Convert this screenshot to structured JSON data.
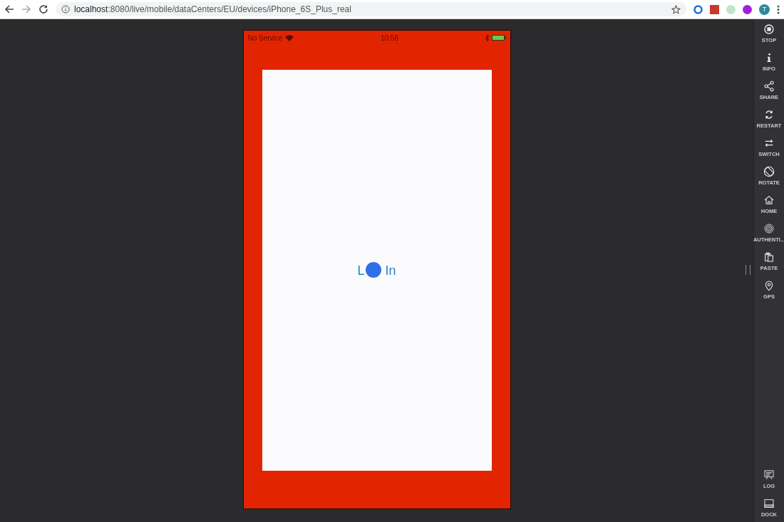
{
  "browser": {
    "url_host": "localhost",
    "url_path": ":8080/live/mobile/dataCenters/EU/devices/iPhone_6S_Plus_real",
    "profile_initial": "T"
  },
  "device": {
    "status_bar": {
      "carrier": "No Service",
      "time": "10:58"
    },
    "screen": {
      "button_text_start": "L",
      "button_text_end": "In",
      "touch_indicator": true
    }
  },
  "sidebar": {
    "tools": [
      {
        "label": "STOP"
      },
      {
        "label": "INFO"
      },
      {
        "label": "SHARE"
      },
      {
        "label": "RESTART"
      },
      {
        "label": "SWITCH"
      },
      {
        "label": "ROTATE"
      },
      {
        "label": "HOME"
      },
      {
        "label": "AUTHENTI..."
      },
      {
        "label": "PASTE"
      },
      {
        "label": "GPS"
      }
    ],
    "bottom_tools": [
      {
        "label": "LOG"
      },
      {
        "label": "DOCK"
      }
    ]
  }
}
